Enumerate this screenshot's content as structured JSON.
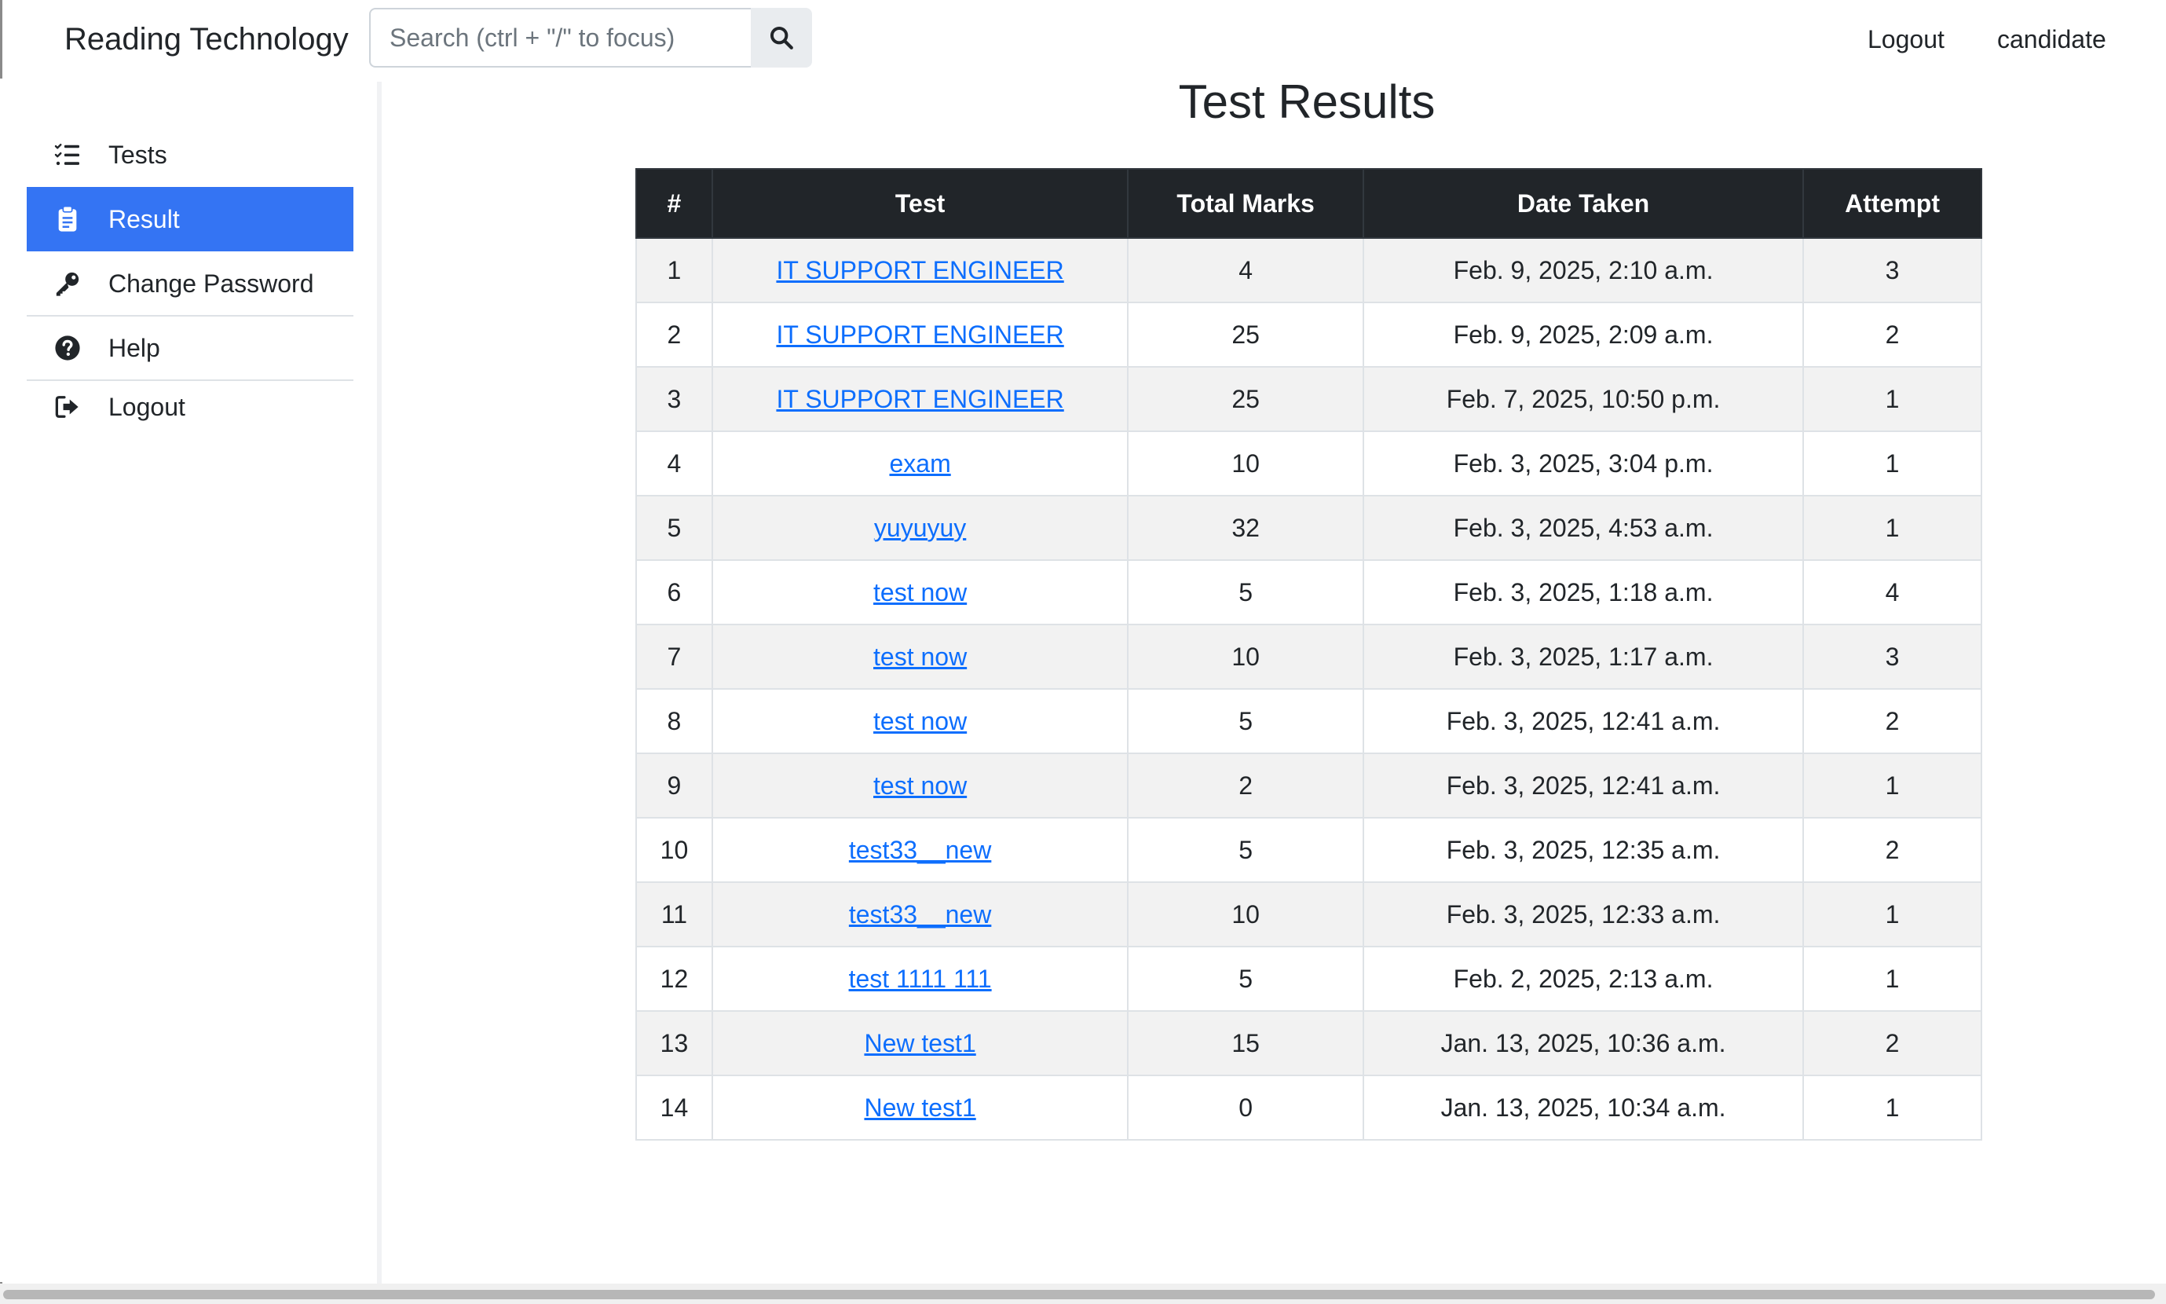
{
  "navbar": {
    "brand": "Reading Technology",
    "search_placeholder": "Search (ctrl + \"/\" to focus)",
    "search_icon": "search-icon",
    "logout_label": "Logout",
    "user_label": "candidate"
  },
  "sidebar": {
    "items": [
      {
        "label": "Tests",
        "icon": "list-check-icon",
        "active": false
      },
      {
        "label": "Result",
        "icon": "clipboard-icon",
        "active": true
      },
      {
        "label": "Change Password",
        "icon": "key-icon",
        "active": false
      },
      {
        "label": "Help",
        "icon": "question-circle-icon",
        "active": false
      },
      {
        "label": "Logout",
        "icon": "sign-out-icon",
        "active": false
      }
    ]
  },
  "main": {
    "title": "Test Results",
    "table": {
      "headers": [
        "#",
        "Test",
        "Total Marks",
        "Date Taken",
        "Attempt"
      ],
      "rows": [
        {
          "num": "1",
          "test": "IT SUPPORT ENGINEER",
          "marks": "4",
          "date": "Feb. 9, 2025, 2:10 a.m.",
          "attempt": "3"
        },
        {
          "num": "2",
          "test": "IT SUPPORT ENGINEER",
          "marks": "25",
          "date": "Feb. 9, 2025, 2:09 a.m.",
          "attempt": "2"
        },
        {
          "num": "3",
          "test": "IT SUPPORT ENGINEER",
          "marks": "25",
          "date": "Feb. 7, 2025, 10:50 p.m.",
          "attempt": "1"
        },
        {
          "num": "4",
          "test": "exam",
          "marks": "10",
          "date": "Feb. 3, 2025, 3:04 p.m.",
          "attempt": "1"
        },
        {
          "num": "5",
          "test": "yuyuyuy",
          "marks": "32",
          "date": "Feb. 3, 2025, 4:53 a.m.",
          "attempt": "1"
        },
        {
          "num": "6",
          "test": "test now",
          "marks": "5",
          "date": "Feb. 3, 2025, 1:18 a.m.",
          "attempt": "4"
        },
        {
          "num": "7",
          "test": "test now",
          "marks": "10",
          "date": "Feb. 3, 2025, 1:17 a.m.",
          "attempt": "3"
        },
        {
          "num": "8",
          "test": "test now",
          "marks": "5",
          "date": "Feb. 3, 2025, 12:41 a.m.",
          "attempt": "2"
        },
        {
          "num": "9",
          "test": "test now",
          "marks": "2",
          "date": "Feb. 3, 2025, 12:41 a.m.",
          "attempt": "1"
        },
        {
          "num": "10",
          "test": "test33__new",
          "marks": "5",
          "date": "Feb. 3, 2025, 12:35 a.m.",
          "attempt": "2"
        },
        {
          "num": "11",
          "test": "test33__new",
          "marks": "10",
          "date": "Feb. 3, 2025, 12:33 a.m.",
          "attempt": "1"
        },
        {
          "num": "12",
          "test": "test 1111 111",
          "marks": "5",
          "date": "Feb. 2, 2025, 2:13 a.m.",
          "attempt": "1"
        },
        {
          "num": "13",
          "test": "New test1",
          "marks": "15",
          "date": "Jan. 13, 2025, 10:36 a.m.",
          "attempt": "2"
        },
        {
          "num": "14",
          "test": "New test1",
          "marks": "0",
          "date": "Jan. 13, 2025, 10:34 a.m.",
          "attempt": "1"
        }
      ]
    }
  },
  "colors": {
    "accent": "#3474f3",
    "link": "#0d6efd",
    "table_header_bg": "#212529"
  }
}
